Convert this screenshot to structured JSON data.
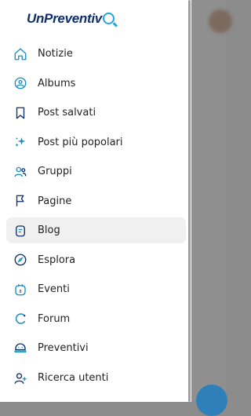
{
  "app": {
    "logo_text": "UnPreventiv"
  },
  "colors": {
    "accent": "#1a8fc4",
    "navy": "#0f2e6b",
    "active_bg": "#f0f0f0"
  },
  "menu": {
    "items": [
      {
        "label": "Notizie",
        "icon": "home-icon"
      },
      {
        "label": "Albums",
        "icon": "album-icon"
      },
      {
        "label": "Post salvati",
        "icon": "bookmark-icon"
      },
      {
        "label": "Post più popolari",
        "icon": "sparkle-icon"
      },
      {
        "label": "Gruppi",
        "icon": "group-icon"
      },
      {
        "label": "Pagine",
        "icon": "flag-icon"
      },
      {
        "label": "Blog",
        "icon": "blog-icon",
        "active": true
      },
      {
        "label": "Esplora",
        "icon": "compass-icon"
      },
      {
        "label": "Eventi",
        "icon": "calendar-icon"
      },
      {
        "label": "Forum",
        "icon": "forum-icon"
      },
      {
        "label": "Preventivi",
        "icon": "quote-icon"
      },
      {
        "label": "Ricerca utenti",
        "icon": "user-search-icon"
      }
    ]
  }
}
